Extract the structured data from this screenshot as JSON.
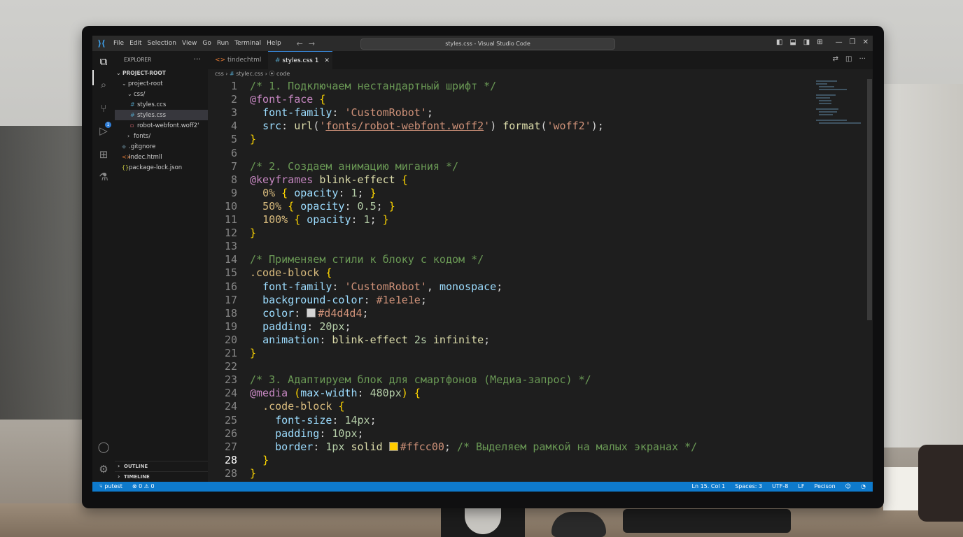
{
  "window": {
    "title": "styles.css - Visual Studio Code"
  },
  "menu": [
    "File",
    "Edit",
    "Selection",
    "View",
    "Go",
    "Run",
    "Terminal",
    "Help"
  ],
  "explorer": {
    "header": "EXPLORER",
    "root": "PROJECT-ROOT",
    "items": [
      {
        "label": "project-root",
        "chev": "⌄",
        "icon": "",
        "indent": 10
      },
      {
        "label": "css/",
        "chev": "⌄",
        "icon": "",
        "indent": 18
      },
      {
        "label": "styles.ccs",
        "chev": "",
        "icon": "#",
        "indent": 22,
        "color": "#519aba"
      },
      {
        "label": "styles.css",
        "chev": "",
        "icon": "#",
        "indent": 22,
        "color": "#519aba",
        "selected": true
      },
      {
        "label": "robot-webfont.woff2'",
        "chev": "",
        "icon": "▫",
        "indent": 22,
        "color": "#e06c75"
      },
      {
        "label": "fonts/",
        "chev": "›",
        "icon": "",
        "indent": 18
      },
      {
        "label": ".gitgnore",
        "chev": "",
        "icon": "◆",
        "indent": 10,
        "color": "#41535b"
      },
      {
        "label": "Indec.htmll",
        "chev": "",
        "icon": "<>",
        "indent": 10,
        "color": "#e37933"
      },
      {
        "label": "package-lock.json",
        "chev": "",
        "icon": "{}",
        "indent": 10,
        "color": "#cbcb41"
      }
    ],
    "outline": "OUTLINE",
    "timeline": "TIMELINE"
  },
  "tabs": [
    {
      "label": "tindechtml",
      "icon": "<>",
      "active": false
    },
    {
      "label": "styles.css 1",
      "icon": "#",
      "active": true
    }
  ],
  "breadcrumb": [
    "css",
    "stylec.css",
    "code"
  ],
  "code_lines": [
    {
      "n": "1",
      "t": [
        [
          "tk-comment",
          "/* 1. Подключаем нестандартный шрифт */"
        ]
      ]
    },
    {
      "n": "2",
      "t": [
        [
          "tk-at",
          "@font-face"
        ],
        [
          "tk-punct",
          " "
        ],
        [
          "tk-brace",
          "{"
        ]
      ]
    },
    {
      "n": "3",
      "t": [
        [
          "tk-punct",
          "  "
        ],
        [
          "tk-prop",
          "font-family"
        ],
        [
          "tk-punct",
          ": "
        ],
        [
          "tk-str",
          "'CustomRobot'"
        ],
        [
          "tk-punct",
          ";"
        ]
      ]
    },
    {
      "n": "4",
      "t": [
        [
          "tk-punct",
          "  "
        ],
        [
          "tk-prop",
          "src"
        ],
        [
          "tk-punct",
          ": "
        ],
        [
          "tk-fn",
          "url"
        ],
        [
          "tk-punct",
          "("
        ],
        [
          "tk-str",
          "'"
        ],
        [
          "tk-strlink",
          "fonts/robot-webfont.woff2"
        ],
        [
          "tk-str",
          "'"
        ],
        [
          "tk-punct",
          ") "
        ],
        [
          "tk-fn",
          "format"
        ],
        [
          "tk-punct",
          "("
        ],
        [
          "tk-str",
          "'woff2'"
        ],
        [
          "tk-punct",
          ");"
        ]
      ]
    },
    {
      "n": "5",
      "t": [
        [
          "tk-brace",
          "}"
        ]
      ]
    },
    {
      "n": "6",
      "t": []
    },
    {
      "n": "7",
      "t": [
        [
          "tk-comment",
          "/* 2. Создаем анимацию мигания */"
        ]
      ]
    },
    {
      "n": "8",
      "t": [
        [
          "tk-at",
          "@keyframes"
        ],
        [
          "tk-punct",
          " "
        ],
        [
          "tk-kw",
          "blink-effect"
        ],
        [
          "tk-punct",
          " "
        ],
        [
          "tk-brace",
          "{"
        ]
      ]
    },
    {
      "n": "9",
      "t": [
        [
          "tk-punct",
          "  "
        ],
        [
          "tk-sel",
          "0%"
        ],
        [
          "tk-punct",
          " "
        ],
        [
          "tk-brace",
          "{"
        ],
        [
          "tk-punct",
          " "
        ],
        [
          "tk-prop",
          "opacity"
        ],
        [
          "tk-punct",
          ": "
        ],
        [
          "tk-num",
          "1"
        ],
        [
          "tk-punct",
          "; "
        ],
        [
          "tk-brace",
          "}"
        ]
      ]
    },
    {
      "n": "10",
      "t": [
        [
          "tk-punct",
          "  "
        ],
        [
          "tk-sel",
          "50%"
        ],
        [
          "tk-punct",
          " "
        ],
        [
          "tk-brace",
          "{"
        ],
        [
          "tk-punct",
          " "
        ],
        [
          "tk-prop",
          "opacity"
        ],
        [
          "tk-punct",
          ": "
        ],
        [
          "tk-num",
          "0.5"
        ],
        [
          "tk-punct",
          "; "
        ],
        [
          "tk-brace",
          "}"
        ]
      ]
    },
    {
      "n": "11",
      "t": [
        [
          "tk-punct",
          "  "
        ],
        [
          "tk-sel",
          "100%"
        ],
        [
          "tk-punct",
          " "
        ],
        [
          "tk-brace",
          "{"
        ],
        [
          "tk-punct",
          " "
        ],
        [
          "tk-prop",
          "opacity"
        ],
        [
          "tk-punct",
          ": "
        ],
        [
          "tk-num",
          "1"
        ],
        [
          "tk-punct",
          "; "
        ],
        [
          "tk-brace",
          "}"
        ]
      ]
    },
    {
      "n": "12",
      "t": [
        [
          "tk-brace",
          "}"
        ]
      ]
    },
    {
      "n": "13",
      "t": []
    },
    {
      "n": "14",
      "t": [
        [
          "tk-comment",
          "/* Применяем стили к блоку с кодом */"
        ]
      ]
    },
    {
      "n": "15",
      "t": [
        [
          "tk-sel",
          ".code-block"
        ],
        [
          "tk-punct",
          " "
        ],
        [
          "tk-brace",
          "{"
        ]
      ]
    },
    {
      "n": "16",
      "t": [
        [
          "tk-punct",
          "  "
        ],
        [
          "tk-prop",
          "font-family"
        ],
        [
          "tk-punct",
          ": "
        ],
        [
          "tk-str",
          "'CustomRobot'"
        ],
        [
          "tk-punct",
          ", "
        ],
        [
          "tk-prop",
          "monospace"
        ],
        [
          "tk-punct",
          ";"
        ]
      ]
    },
    {
      "n": "17",
      "t": [
        [
          "tk-punct",
          "  "
        ],
        [
          "tk-prop",
          "background-color"
        ],
        [
          "tk-punct",
          ": "
        ],
        [
          "tk-val",
          "#1e1e1e"
        ],
        [
          "tk-punct",
          ";"
        ]
      ]
    },
    {
      "n": "18",
      "t": [
        [
          "tk-punct",
          "  "
        ],
        [
          "tk-prop",
          "color"
        ],
        [
          "tk-punct",
          ": "
        ],
        [
          "swatch",
          "#d4d4d4"
        ],
        [
          "tk-val",
          "#d4d4d4"
        ],
        [
          "tk-punct",
          ";"
        ]
      ]
    },
    {
      "n": "19",
      "t": [
        [
          "tk-punct",
          "  "
        ],
        [
          "tk-prop",
          "padding"
        ],
        [
          "tk-punct",
          ": "
        ],
        [
          "tk-num",
          "20px"
        ],
        [
          "tk-punct",
          ";"
        ]
      ]
    },
    {
      "n": "20",
      "t": [
        [
          "tk-punct",
          "  "
        ],
        [
          "tk-prop",
          "animation"
        ],
        [
          "tk-punct",
          ": "
        ],
        [
          "tk-kw",
          "blink-effect"
        ],
        [
          "tk-punct",
          " "
        ],
        [
          "tk-num",
          "2s"
        ],
        [
          "tk-punct",
          " "
        ],
        [
          "tk-kw",
          "infinite"
        ],
        [
          "tk-punct",
          ";"
        ]
      ]
    },
    {
      "n": "21",
      "t": [
        [
          "tk-brace",
          "}"
        ]
      ]
    },
    {
      "n": "22",
      "t": []
    },
    {
      "n": "23",
      "t": [
        [
          "tk-comment",
          "/* 3. Адаптируем блок для смартфонов (Медиа-запрос) */"
        ]
      ]
    },
    {
      "n": "24",
      "t": [
        [
          "tk-at",
          "@media"
        ],
        [
          "tk-punct",
          " "
        ],
        [
          "tk-brace",
          "("
        ],
        [
          "tk-prop",
          "max-width"
        ],
        [
          "tk-punct",
          ": "
        ],
        [
          "tk-num",
          "480px"
        ],
        [
          "tk-brace",
          ")"
        ],
        [
          "tk-punct",
          " "
        ],
        [
          "tk-brace",
          "{"
        ]
      ]
    },
    {
      "n": "24",
      "t": [
        [
          "tk-punct",
          "  "
        ],
        [
          "tk-sel",
          ".code-block"
        ],
        [
          "tk-punct",
          " "
        ],
        [
          "tk-brace",
          "{"
        ]
      ]
    },
    {
      "n": "25",
      "t": [
        [
          "tk-punct",
          "    "
        ],
        [
          "tk-prop",
          "font-size"
        ],
        [
          "tk-punct",
          ": "
        ],
        [
          "tk-num",
          "14px"
        ],
        [
          "tk-punct",
          ";"
        ]
      ]
    },
    {
      "n": "26",
      "t": [
        [
          "tk-punct",
          "    "
        ],
        [
          "tk-prop",
          "padding"
        ],
        [
          "tk-punct",
          ": "
        ],
        [
          "tk-num",
          "10px"
        ],
        [
          "tk-punct",
          ";"
        ]
      ]
    },
    {
      "n": "27",
      "t": [
        [
          "tk-punct",
          "    "
        ],
        [
          "tk-prop",
          "border"
        ],
        [
          "tk-punct",
          ": "
        ],
        [
          "tk-num",
          "1px"
        ],
        [
          "tk-punct",
          " "
        ],
        [
          "tk-kw",
          "solid"
        ],
        [
          "tk-punct",
          " "
        ],
        [
          "swatch",
          "#ffcc00"
        ],
        [
          "tk-val",
          "#ffcc00"
        ],
        [
          "tk-punct",
          "; "
        ],
        [
          "tk-comment",
          "/* Выделяем рамкой на малых экранах */"
        ]
      ]
    },
    {
      "n": "28",
      "t": [
        [
          "tk-punct",
          "  "
        ],
        [
          "tk-brace",
          "}"
        ]
      ],
      "current": true
    },
    {
      "n": "28",
      "t": [
        [
          "tk-brace",
          "}"
        ]
      ]
    }
  ],
  "statusbar": {
    "branch": "putest",
    "problems": "⊗ 0 ⚠ 0",
    "position": "Ln 15. Col 1",
    "spaces": "Spaces: 3",
    "encoding": "UTF-8",
    "eol": "LF",
    "language": "Pecison"
  },
  "colors": {
    "accent": "#0e7acc",
    "editor_bg": "#1e1e1e",
    "sidebar_bg": "#181818"
  }
}
